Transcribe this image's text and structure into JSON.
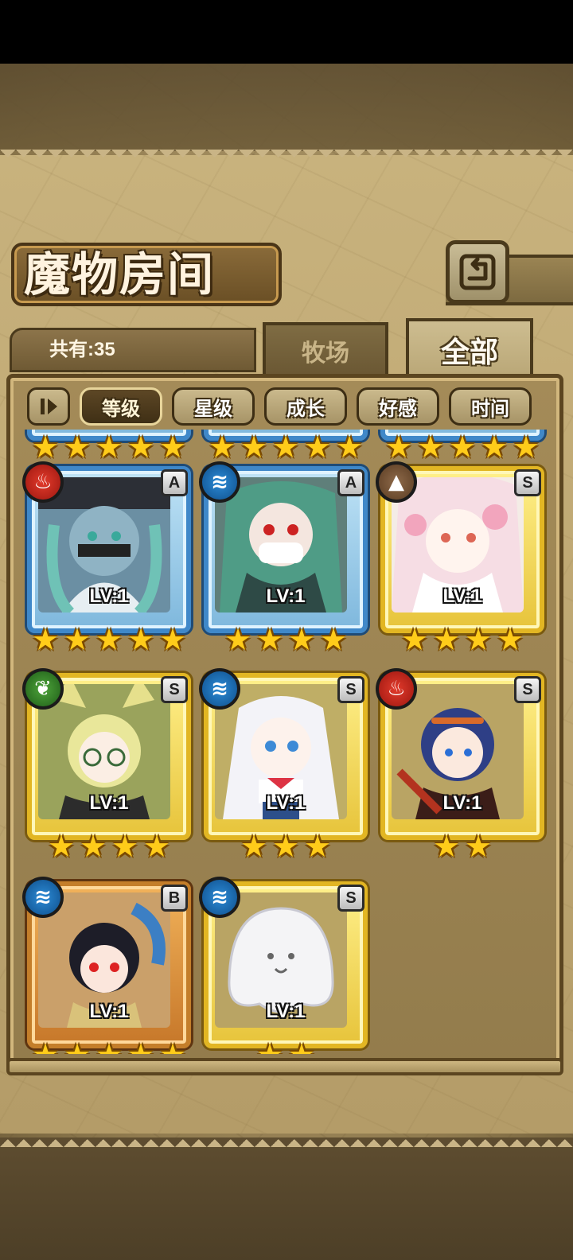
{
  "header": {
    "title": "魔物房间"
  },
  "count_label": "共有:35",
  "tabs": [
    {
      "label": "牧场",
      "active": false
    },
    {
      "label": "全部",
      "active": true
    }
  ],
  "sort": {
    "buttons": [
      {
        "label": "等级",
        "active": true
      },
      {
        "label": "星级",
        "active": false
      },
      {
        "label": "成长",
        "active": false
      },
      {
        "label": "好感",
        "active": false
      },
      {
        "label": "时间",
        "active": false
      }
    ]
  },
  "monsters": [
    {
      "element": "fire",
      "rank": "A",
      "level": "LV:1",
      "stars": 5,
      "frame": "blue"
    },
    {
      "element": "water",
      "rank": "A",
      "level": "LV:1",
      "stars": 4,
      "frame": "blue"
    },
    {
      "element": "earth",
      "rank": "S",
      "level": "LV:1",
      "stars": 4,
      "frame": "gold"
    },
    {
      "element": "wood",
      "rank": "S",
      "level": "LV:1",
      "stars": 4,
      "frame": "gold"
    },
    {
      "element": "water",
      "rank": "S",
      "level": "LV:1",
      "stars": 3,
      "frame": "gold"
    },
    {
      "element": "fire",
      "rank": "S",
      "level": "LV:1",
      "stars": 2,
      "frame": "gold"
    },
    {
      "element": "water",
      "rank": "B",
      "level": "LV:1",
      "stars": 5,
      "frame": "bronze"
    },
    {
      "element": "water",
      "rank": "S",
      "level": "LV:1",
      "stars": 2,
      "frame": "gold"
    }
  ],
  "icons": {
    "back": "back-arrow-icon",
    "sort_toggle": "sort-toggle-icon",
    "fire": "fire-element-icon",
    "water": "water-element-icon",
    "earth": "earth-element-icon",
    "wood": "wood-element-icon",
    "star": "star-icon"
  },
  "colors": {
    "gold_frame": "#e2b623",
    "blue_frame": "#3f88c9",
    "bronze_frame": "#c47e2a",
    "fire": "#e23a2b",
    "water": "#2c8bd6",
    "earth": "#8e6a4a",
    "wood": "#4ea43b"
  }
}
